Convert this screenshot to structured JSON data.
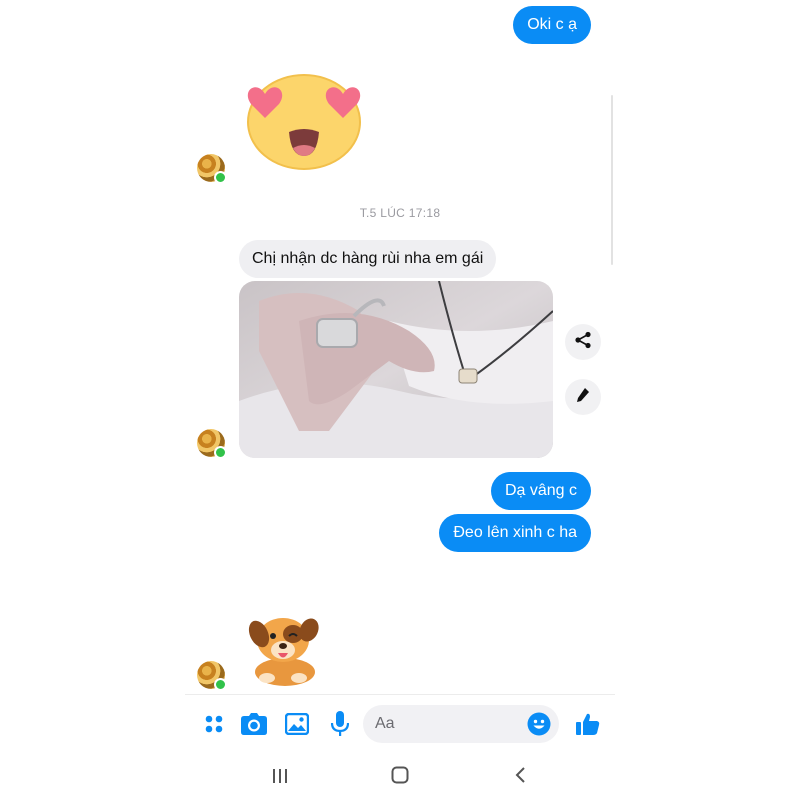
{
  "messages": {
    "out_1": "Oki c ạ",
    "timestamp": "T.5 LÚC 17:18",
    "in_1": "Chị nhận dc hàng rùi nha em gái",
    "out_2": "Dạ vâng c",
    "out_3": "Đeo lên xinh c ha"
  },
  "composer": {
    "placeholder": "Aa"
  },
  "icons": {
    "apps": "four-dots-icon",
    "camera": "camera-icon",
    "gallery": "image-icon",
    "mic": "microphone-icon",
    "emoji": "smiley-icon",
    "like": "thumbs-up-icon",
    "share": "share-icon",
    "edit": "pencil-icon",
    "nav_recent": "recent-apps-icon",
    "nav_home": "home-icon",
    "nav_back": "back-icon"
  },
  "colors": {
    "accent": "#0a8cf5",
    "incoming_bubble": "#efeff2",
    "online": "#31c24a"
  }
}
